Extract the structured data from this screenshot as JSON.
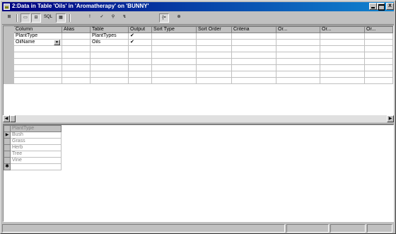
{
  "window": {
    "title": "2:Data in Table 'Oils' in 'Aromatherapy' on 'BUNNY'",
    "min_label": "",
    "max_label": "",
    "close_label": "X"
  },
  "toolbar": {
    "tools": [
      {
        "name": "properties-tool",
        "glyph": "⊞"
      },
      {
        "name": "diagram-pane-tool",
        "glyph": "▭"
      },
      {
        "name": "grid-pane-tool",
        "glyph": "⊟"
      },
      {
        "name": "sql-pane-tool",
        "glyph": "SQL"
      },
      {
        "name": "results-pane-tool",
        "glyph": "▦"
      },
      {
        "name": "run-tool",
        "glyph": "!"
      },
      {
        "name": "verify-sql-tool",
        "glyph": "✓"
      },
      {
        "name": "add-filter-tool",
        "glyph": "⚲"
      },
      {
        "name": "remove-filter-tool",
        "glyph": "↯"
      },
      {
        "name": "group-by-tool",
        "glyph": "{="
      },
      {
        "name": "add-table-tool",
        "glyph": "⊕"
      }
    ]
  },
  "criteria_grid": {
    "headers": [
      "Column",
      "Alias",
      "Table",
      "Output",
      "Sort Type",
      "Sort Order",
      "Criteria",
      "Or...",
      "Or...",
      "Or..."
    ],
    "rows": [
      {
        "column": "PlantType",
        "alias": "",
        "table": "PlantTypes",
        "output": "✔"
      },
      {
        "column": "OilName",
        "alias": "",
        "table": "Oils",
        "output": "✔"
      }
    ]
  },
  "results_grid": {
    "header": "PlantType",
    "rows": [
      "Bush",
      "Grass",
      "Herb",
      "Tree",
      "Vine"
    ],
    "current_marker": "▶",
    "new_row_marker": "✱"
  }
}
